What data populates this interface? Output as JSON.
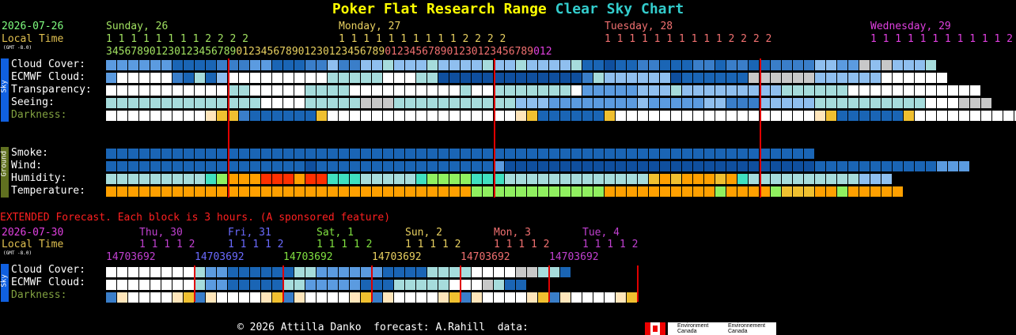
{
  "title": {
    "part1": "Poker Flat Research Range",
    "part2": "Clear Sky Chart"
  },
  "colors": {
    "title1": "#ffff00",
    "title2": "#33cccc",
    "date": "#80ff80",
    "localtime": "#e0c050",
    "day_green": "#a0e060",
    "day_yellow": "#e8d060",
    "day_red": "#f07070",
    "day_magenta": "#e040e0",
    "darkness_label": "#80a040",
    "extended": "#ff2020"
  },
  "main": {
    "date": "2026-07-26",
    "local_time": "Local Time",
    "gmt": "(GMT -8.0)",
    "days": [
      {
        "label": "Sunday, 26",
        "color": "#a0e060",
        "tens": "1 1 1 1 1 1 1 1 2 2 2 2",
        "ones_from": 3
      },
      {
        "label": "Monday, 27",
        "color": "#e8d060",
        "tens": "1 1 1 1 1 1 1 1 1 1 2 2 2 2"
      },
      {
        "label": "Tuesday, 28",
        "color": "#f07070",
        "tens": "1 1 1 1 1 1 1 1 1 1 2 2 2 2"
      },
      {
        "label": "Wednesday, 29",
        "color": "#e040e0",
        "tens": "1 1 1 1 1 1 1 1 1 1 1 2 2 2"
      }
    ],
    "hour_ones": "345678901230123456789012345678901230123456789012345678901230123456789012",
    "sky_tab": "Sky",
    "ground_tab": "Ground",
    "rows": {
      "cloud_cover": "Cloud Cover:",
      "ecmwf": "ECMWF Cloud:",
      "transparency": "Transparency:",
      "seeing": "Seeing:",
      "darkness": "Darkness:",
      "smoke": "Smoke:",
      "wind": "Wind:",
      "humidity": "Humidity:",
      "temperature": "Temperature:"
    }
  },
  "extended": {
    "heading": "EXTENDED Forecast. Each block is 3 hours. (A sponsored feature)",
    "date": "2026-07-30",
    "local_time": "Local Time",
    "gmt": "(GMT -8.0)",
    "days": [
      {
        "label": "Thu, 30",
        "color": "#c040d0"
      },
      {
        "label": "Fri, 31",
        "color": "#6a6aff"
      },
      {
        "label": "Sat, 1",
        "color": "#80e040"
      },
      {
        "label": "Sun, 2",
        "color": "#e8d060"
      },
      {
        "label": "Mon, 3",
        "color": "#f07070"
      },
      {
        "label": "Tue, 4",
        "color": "#c040d0"
      }
    ],
    "tens_group": "1 1 1 1 2",
    "hours_group": "14703692",
    "rows": {
      "cloud_cover": "Cloud Cover:",
      "ecmwf": "ECMWF Cloud:",
      "darkness": "Darkness:"
    }
  },
  "footer": {
    "text": "© 2026 Attilla Danko  forecast: A.Rahill  data:",
    "env_en": "Environment Canada",
    "env_fr": "Environnement Canada"
  }
}
